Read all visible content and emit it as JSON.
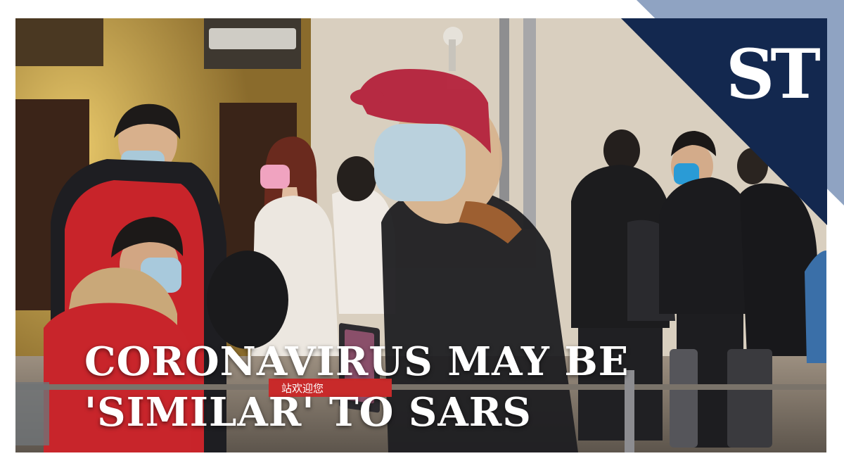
{
  "thumbnail": {
    "headline_line1": "CORONAVIRUS MAY BE",
    "headline_line2": "'SIMILAR' TO SARS",
    "logo_text": "ST",
    "colors": {
      "ribbon_navy": "#13284f",
      "ribbon_edge": "#8fa3c2",
      "headline": "#ffffff",
      "background": "#ffffff"
    }
  },
  "signage": {
    "gate_banner": "站欢迎您"
  }
}
